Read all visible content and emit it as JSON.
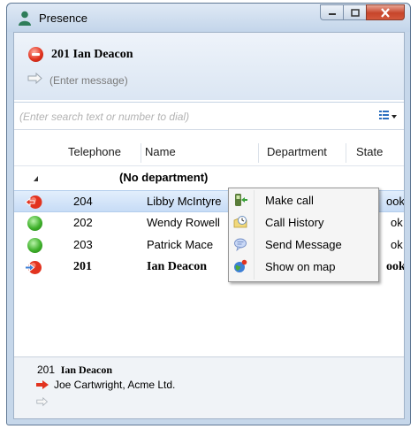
{
  "window": {
    "title": "Presence"
  },
  "user": {
    "line": "201 Ian Deacon",
    "message_placeholder": "(Enter message)"
  },
  "search": {
    "placeholder": "(Enter search text or number to dial)"
  },
  "columns": [
    "Telephone",
    "Name",
    "Department",
    "State"
  ],
  "group": {
    "label": "(No department)"
  },
  "rows": [
    {
      "phone": "204",
      "name": "Libby McIntyre",
      "state": "ook",
      "status": "busy-call",
      "selected": true,
      "bold": false
    },
    {
      "phone": "202",
      "name": "Wendy Rowell",
      "state": "ok",
      "status": "available",
      "selected": false,
      "bold": false
    },
    {
      "phone": "203",
      "name": "Patrick Mace",
      "state": "ok",
      "status": "available",
      "selected": false,
      "bold": false
    },
    {
      "phone": "201",
      "name": "Ian Deacon",
      "state": "ook",
      "status": "self-call",
      "selected": false,
      "bold": true
    }
  ],
  "context_menu": {
    "items": [
      {
        "label": "Make call",
        "icon": "phone-call-icon"
      },
      {
        "label": "Call History",
        "icon": "clock-history-icon"
      },
      {
        "label": "Send Message",
        "icon": "speech-bubble-icon"
      },
      {
        "label": "Show on map",
        "icon": "globe-icon"
      }
    ]
  },
  "bottom_panel": {
    "phone": "201",
    "name": "Ian Deacon",
    "call_info": "Joe Cartwright, Acme Ltd."
  },
  "colors": {
    "busy": "#e2331f",
    "available": "#3fb12b",
    "selection": "#cfe2f8"
  }
}
